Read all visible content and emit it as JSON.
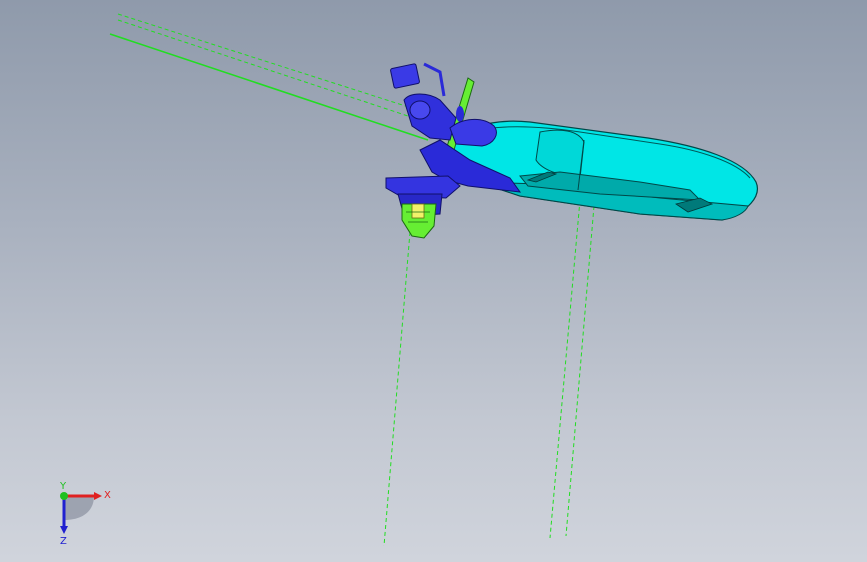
{
  "viewport": {
    "background_top": "#8f9aab",
    "background_bottom": "#d0d4dc"
  },
  "model": {
    "body_color": "#00e6e6",
    "bracket_color": "#2a2ad8",
    "accent_green": "#55dd22",
    "sketch_color": "#22dd22"
  },
  "triad": {
    "x_label": "X",
    "y_label": "Y",
    "z_label": "Z",
    "x_color": "#e02020",
    "y_color": "#20c020",
    "z_color": "#2020d0"
  }
}
